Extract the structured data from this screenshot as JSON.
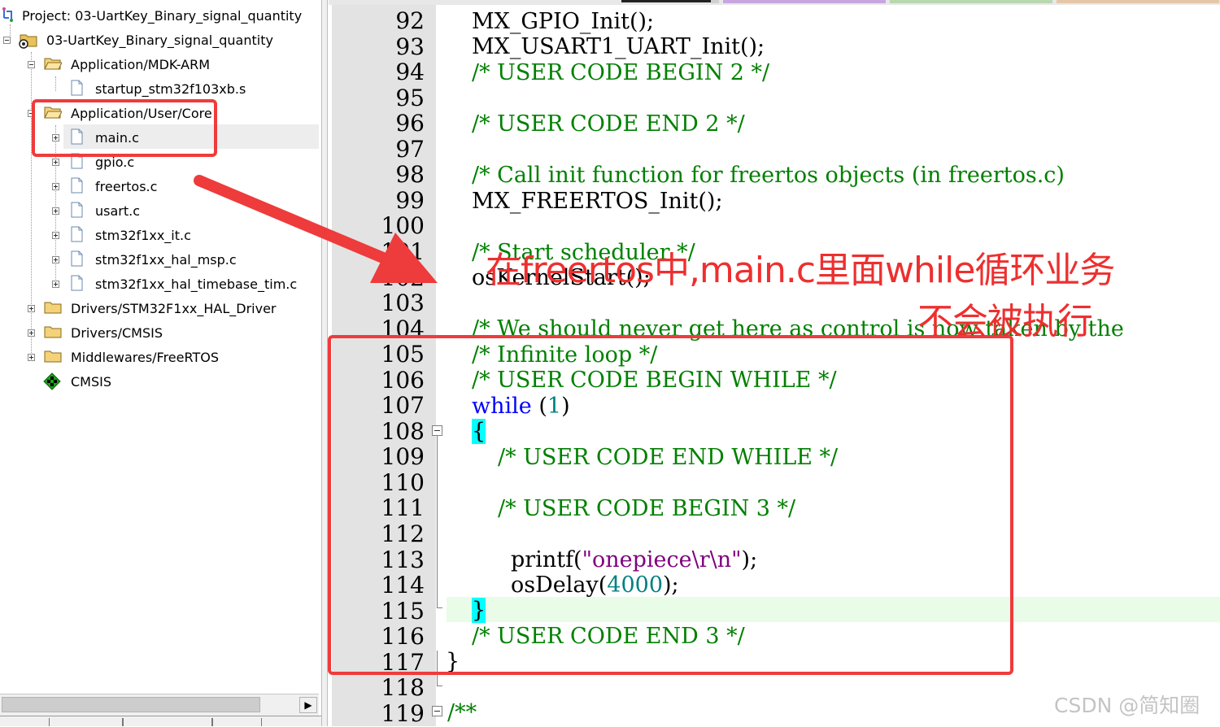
{
  "project_tree": {
    "project_title": "Project: 03-UartKey_Binary_signal_quantity",
    "target": "03-UartKey_Binary_signal_quantity",
    "group_mdk": "Application/MDK-ARM",
    "file_startup": "startup_stm32f103xb.s",
    "group_user_core": "Application/User/Core",
    "files_core": [
      "main.c",
      "gpio.c",
      "freertos.c",
      "usart.c",
      "stm32f1xx_it.c",
      "stm32f1xx_hal_msp.c",
      "stm32f1xx_hal_timebase_tim.c"
    ],
    "group_hal": "Drivers/STM32F1xx_HAL_Driver",
    "group_cmsis": "Drivers/CMSIS",
    "group_freertos": "Middlewares/FreeRTOS",
    "cmsis_component": "CMSIS"
  },
  "scrollbar": {
    "right_arrow": "▶"
  },
  "editor": {
    "line_numbers": [
      "92",
      "93",
      "94",
      "95",
      "96",
      "97",
      "98",
      "99",
      "100",
      "101",
      "102",
      "103",
      "104",
      "105",
      "106",
      "107",
      "108",
      "109",
      "110",
      "111",
      "112",
      "113",
      "114",
      "115",
      "116",
      "117",
      "118",
      "119"
    ],
    "code": {
      "l92": "MX_GPIO_Init();",
      "l93": "MX_USART1_UART_Init();",
      "l94": "/* USER CODE BEGIN 2 */",
      "l96": "/* USER CODE END 2 */",
      "l98": "/* Call init function for freertos objects (in freertos.c)",
      "l99": "MX_FREERTOS_Init();",
      "l101": "/* Start scheduler */",
      "l102": "osKernelStart();",
      "l104": "/* We should never get here as control is now taken by the",
      "l105": "/* Infinite loop */",
      "l106": "/* USER CODE BEGIN WHILE */",
      "l107_kw": "while",
      "l107_num": "1",
      "l108": "{",
      "l109": "/* USER CODE END WHILE */",
      "l111": "/* USER CODE BEGIN 3 */",
      "l113_fn": "printf(",
      "l113_str": "\"onepiece\\r\\n\"",
      "l113_end": ");",
      "l114_fn": "osDelay",
      "l114_num": "4000",
      "l115": "}",
      "l116": "/* USER CODE END 3 */",
      "l117": "}",
      "l119": "/**"
    }
  },
  "annotation": {
    "line1": "在freertos中,main.c里面while循环业务",
    "line2": "不会被执行"
  },
  "watermark": "CSDN @简知圈",
  "colors": {
    "annotation_red": "#ef3b3b",
    "comment_green": "#008000",
    "keyword_blue": "#0000ff",
    "number_teal": "#008080",
    "string_purple": "#800080"
  }
}
